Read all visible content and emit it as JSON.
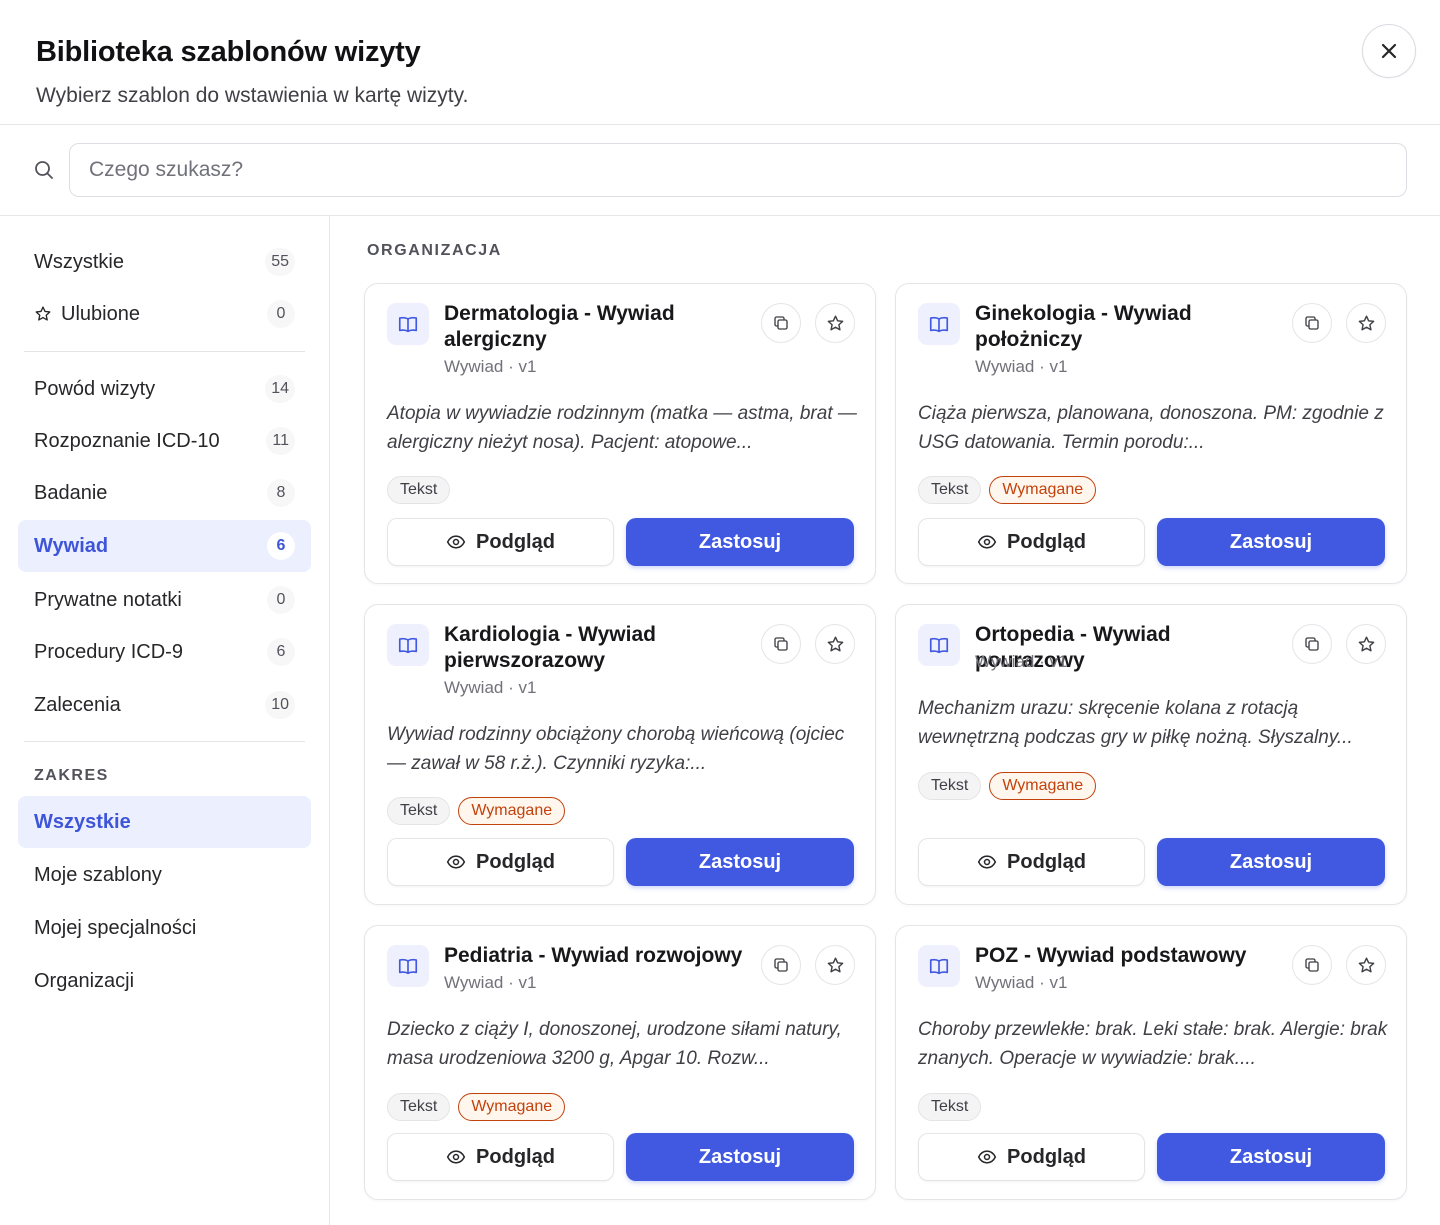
{
  "header": {
    "title": "Biblioteka szablonów wizyty",
    "subtitle": "Wybierz szablon do wstawienia w kartę wizyty.",
    "close_icon": "close-icon"
  },
  "search": {
    "placeholder": "Czego szukasz?",
    "value": "",
    "icon": "search-icon"
  },
  "sidebar": {
    "top_items": [
      {
        "label": "Wszystkie",
        "count": "55",
        "active": false
      },
      {
        "label": "Ulubione",
        "count": "0",
        "active": false,
        "icon": "star-icon"
      }
    ],
    "categories": [
      {
        "label": "Powód wizyty",
        "count": "14",
        "active": false
      },
      {
        "label": "Rozpoznanie ICD-10",
        "count": "11",
        "active": false
      },
      {
        "label": "Badanie",
        "count": "8",
        "active": false
      },
      {
        "label": "Wywiad",
        "count": "6",
        "active": true
      },
      {
        "label": "Prywatne notatki",
        "count": "0",
        "active": false
      },
      {
        "label": "Procedury ICD-9",
        "count": "6",
        "active": false
      },
      {
        "label": "Zalecenia",
        "count": "10",
        "active": false
      }
    ],
    "scope_label": "ZAKRES",
    "scope_items": [
      {
        "label": "Wszystkie",
        "active": true
      },
      {
        "label": "Moje szablony",
        "active": false
      },
      {
        "label": "Mojej specjalności",
        "active": false
      },
      {
        "label": "Organizacji",
        "active": false
      }
    ]
  },
  "main": {
    "section_label": "ORGANIZACJA",
    "cards": [
      {
        "title": "Dermatologia - Wywiad alergiczny",
        "meta": "Wywiad · v1",
        "description": "Atopia w wywiadzie rodzinnym (matka — astma, brat — alergiczny nieżyt nosa). Pacjent: atopowe...",
        "tags": [
          "Tekst"
        ],
        "preview_label": "Podgląd",
        "apply_label": "Zastosuj"
      },
      {
        "title": "Ginekologia - Wywiad położniczy",
        "meta": "Wywiad · v1",
        "description": "Ciąża pierwsza, planowana, donoszona. PM: zgodnie z USG datowania. Termin porodu:...",
        "tags": [
          "Tekst",
          "Wymagane"
        ],
        "preview_label": "Podgląd",
        "apply_label": "Zastosuj"
      },
      {
        "title": "Kardiologia - Wywiad pierwszorazowy",
        "meta": "Wywiad · v1",
        "description": "Wywiad rodzinny obciążony chorobą wieńcową (ojciec — zawał w 58 r.ż.). Czynniki ryzyka:...",
        "tags": [
          "Tekst",
          "Wymagane"
        ],
        "preview_label": "Podgląd",
        "apply_label": "Zastosuj"
      },
      {
        "title": "Ortopedia - Wywiad pourazowy",
        "meta": "Wywiad · v1",
        "description": "Mechanizm urazu: skręcenie kolana z rotacją wewnętrzną podczas gry w piłkę nożną. Słyszalny...",
        "tags": [
          "Tekst",
          "Wymagane"
        ],
        "preview_label": "Podgląd",
        "apply_label": "Zastosuj"
      },
      {
        "title": "Pediatria - Wywiad rozwojowy",
        "meta": "Wywiad · v1",
        "description": "Dziecko z ciąży I, donoszonej, urodzone siłami natury, masa urodzeniowa 3200 g, Apgar 10. Rozw...",
        "tags": [
          "Tekst",
          "Wymagane"
        ],
        "preview_label": "Podgląd",
        "apply_label": "Zastosuj"
      },
      {
        "title": "POZ - Wywiad podstawowy",
        "meta": "Wywiad · v1",
        "description": "Choroby przewlekłe: brak. Leki stałe: brak. Alergie: brak znanych. Operacje w wywiadzie: brak....",
        "tags": [
          "Tekst"
        ],
        "preview_label": "Podgląd",
        "apply_label": "Zastosuj"
      }
    ]
  },
  "colors": {
    "accent": "#4059e0",
    "active_bg": "#eceffd",
    "required": "#c2410c"
  }
}
